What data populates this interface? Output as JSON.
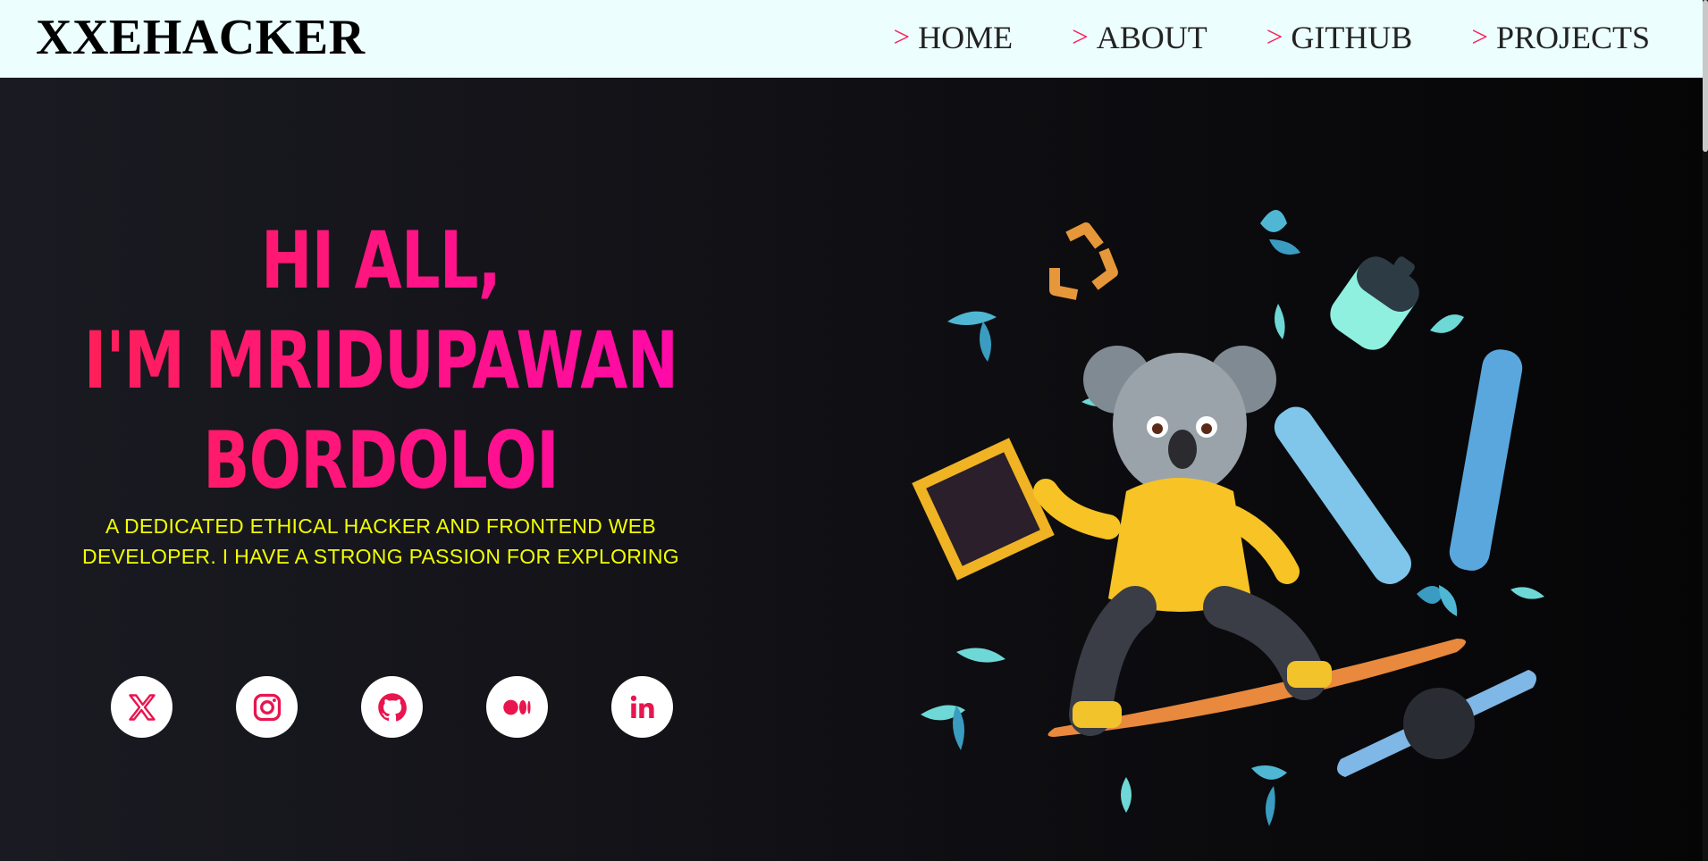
{
  "brand": "XXEHACKER",
  "nav": {
    "arrow": ">",
    "items": [
      "HOME",
      "ABOUT",
      "GITHUB",
      "PROJECTS"
    ]
  },
  "hero": {
    "line1": "HI ALL,",
    "line2": "I'M MRIDUPAWAN",
    "line3": "BORDOLOI",
    "description": "A DEDICATED ETHICAL HACKER AND FRONTEND WEB DEVELOPER. I HAVE A STRONG PASSION FOR EXPLORING"
  },
  "socials": [
    {
      "name": "x",
      "icon": "x-icon"
    },
    {
      "name": "instagram",
      "icon": "instagram-icon"
    },
    {
      "name": "github",
      "icon": "github-icon"
    },
    {
      "name": "medium",
      "icon": "medium-icon"
    },
    {
      "name": "linkedin",
      "icon": "linkedin-icon"
    }
  ],
  "colors": {
    "accent": "#ff1f5a",
    "description": "#f2ff00",
    "nav_bg": "#ecfefd",
    "hero_bg": "#121217"
  }
}
